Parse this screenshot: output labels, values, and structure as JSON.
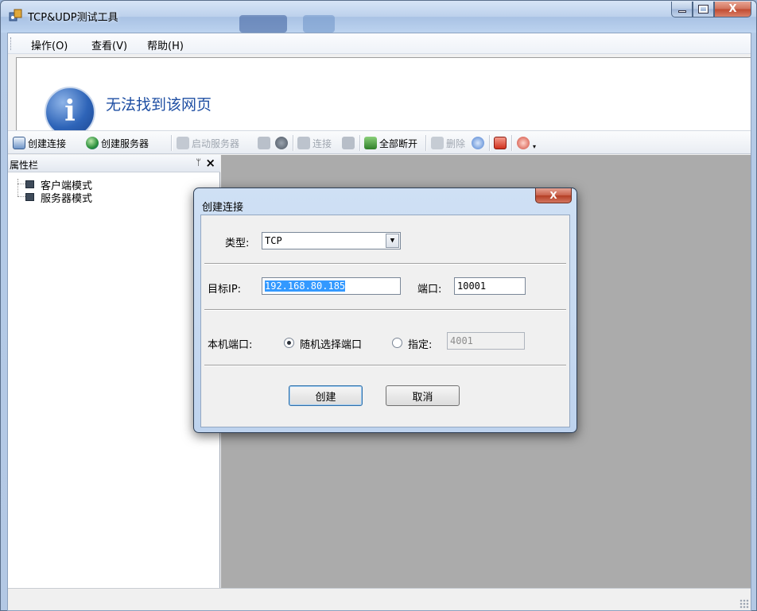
{
  "window": {
    "title": "TCP&UDP测试工具",
    "controls": {
      "minimize": "—",
      "maximize": "□",
      "close": "X"
    }
  },
  "menubar": {
    "items": [
      {
        "label": "操作(O)"
      },
      {
        "label": "查看(V)"
      },
      {
        "label": "帮助(H)"
      }
    ]
  },
  "browser": {
    "message": "无法找到该网页",
    "icon_glyph": "i"
  },
  "toolbar": {
    "create_connection": "创建连接",
    "create_server": "创建服务器",
    "start_server": "启动服务器",
    "connect": "连接",
    "disconnect_all": "全部断开",
    "delete": "删除"
  },
  "panel": {
    "title": "属性栏",
    "pin": "ᛘ",
    "close": "×",
    "tree": [
      {
        "label": "客户端模式"
      },
      {
        "label": "服务器模式"
      }
    ]
  },
  "dialog": {
    "title": "创建连接",
    "close": "X",
    "type_label": "类型:",
    "type_value": "TCP",
    "target_ip_label": "目标IP:",
    "target_ip_value": "192.168.80.185",
    "port_label": "端口:",
    "port_value": "10001",
    "local_port_label": "本机端口:",
    "random_port_label": "随机选择端口",
    "specify_label": "指定:",
    "specify_value": "4001",
    "random_port_selected": true,
    "create_button": "创建",
    "cancel_button": "取消"
  },
  "colors": {
    "browser_message": "#1f4fa3",
    "workspace": "#ababab",
    "selection": "#3399ff"
  }
}
